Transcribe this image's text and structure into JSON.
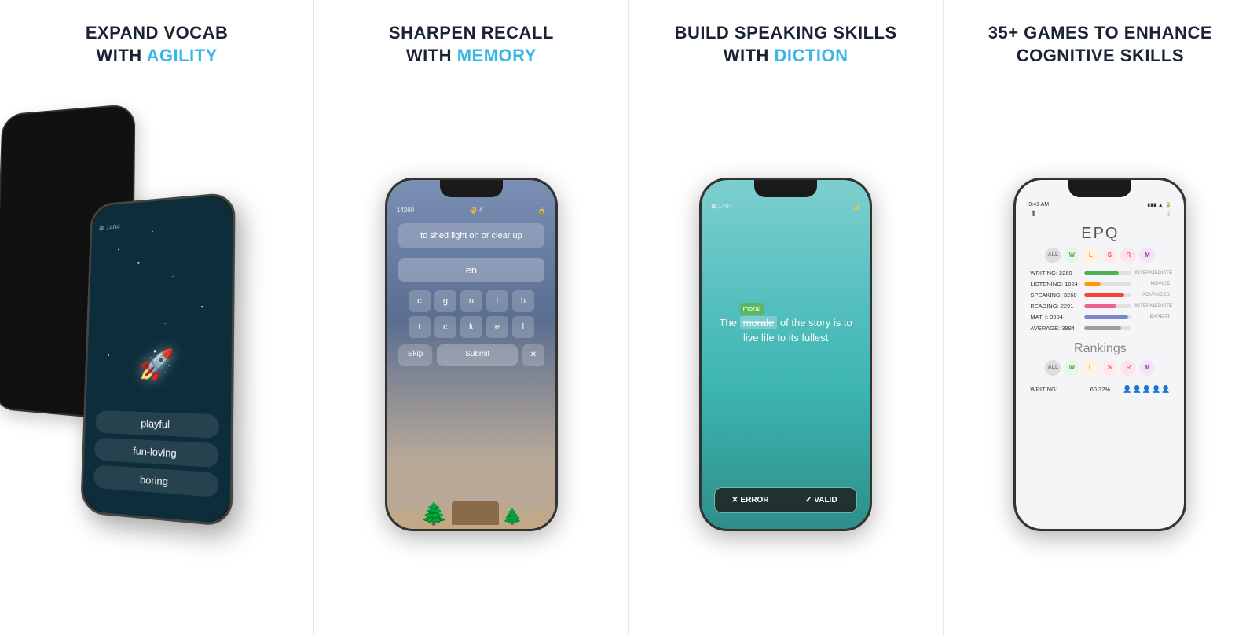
{
  "panel1": {
    "title_line1": "EXPAND VOCAB",
    "title_line2": "WITH ",
    "title_highlight": "AGILITY",
    "score": "1404",
    "choices": [
      "playful",
      "fun-loving",
      "boring"
    ]
  },
  "panel2": {
    "title_line1": "SHARPEN RECALL",
    "title_line2": "WITH ",
    "title_highlight": "MEMORY",
    "score": "14260",
    "lives": "4",
    "definition": "to shed light on or clear up",
    "input_text": "en",
    "keys_row1": [
      "c",
      "g",
      "n",
      "i",
      "h"
    ],
    "keys_row2": [
      "t",
      "c",
      "k",
      "e",
      "l"
    ],
    "skip_label": "Skip",
    "submit_label": "Submit"
  },
  "panel3": {
    "title_line1": "BUILD SPEAKING SKILLS",
    "title_line2": "WITH ",
    "title_highlight": "DICTION",
    "score": "1404",
    "sentence_prefix": "The ",
    "word_incorrect": "morale",
    "word_correct": "moral",
    "sentence_suffix": " of the story is to live life to its fullest",
    "error_btn": "✕  ERROR",
    "valid_btn": "✓  VALID"
  },
  "panel4": {
    "title_line1": "35+ GAMES TO ENHANCE",
    "title_line2": "COGNITIVE SKILLS",
    "app_title": "EPQ",
    "time": "9:41 AM",
    "filters": [
      {
        "label": "ALL",
        "color": "#888",
        "bg": "#ddd"
      },
      {
        "label": "W",
        "color": "#4CAF50",
        "bg": "#e8f5e9"
      },
      {
        "label": "L",
        "color": "#FF9800",
        "bg": "#fff3e0"
      },
      {
        "label": "S",
        "color": "#F44336",
        "bg": "#ffebee"
      },
      {
        "label": "R",
        "color": "#f06292",
        "bg": "#fce4ec"
      },
      {
        "label": "M",
        "color": "#9C27B0",
        "bg": "#f3e5f5"
      }
    ],
    "stats": [
      {
        "label": "WRITING: 2260",
        "level": "INTERMEDIATE",
        "pct": 72,
        "color": "#4CAF50"
      },
      {
        "label": "LISTENING: 1024",
        "level": "NOVICE",
        "pct": 35,
        "color": "#FF9800"
      },
      {
        "label": "SPEAKING: 3268",
        "level": "ADVANCED",
        "pct": 85,
        "color": "#F44336"
      },
      {
        "label": "READING: 2291",
        "level": "INTERMEDIATE",
        "pct": 68,
        "color": "#f06292"
      },
      {
        "label": "MATH: 3994",
        "level": "EXPERT",
        "pct": 92,
        "color": "#7986CB"
      },
      {
        "label": "AVERAGE: 3894",
        "level": "",
        "pct": 78,
        "color": "#9E9E9E"
      }
    ],
    "rankings_title": "Rankings",
    "rankings_filters": [
      {
        "label": "ALL",
        "color": "#888",
        "bg": "#ddd"
      },
      {
        "label": "W",
        "color": "#4CAF50",
        "bg": "#e8f5e9"
      },
      {
        "label": "L",
        "color": "#FF9800",
        "bg": "#fff3e0"
      },
      {
        "label": "S",
        "color": "#F44336",
        "bg": "#ffebee"
      },
      {
        "label": "R",
        "color": "#f06292",
        "bg": "#fce4ec"
      },
      {
        "label": "M",
        "color": "#9C27B0",
        "bg": "#f3e5f5"
      }
    ],
    "rank_label": "WRITING:",
    "rank_pct": "60.32%"
  }
}
